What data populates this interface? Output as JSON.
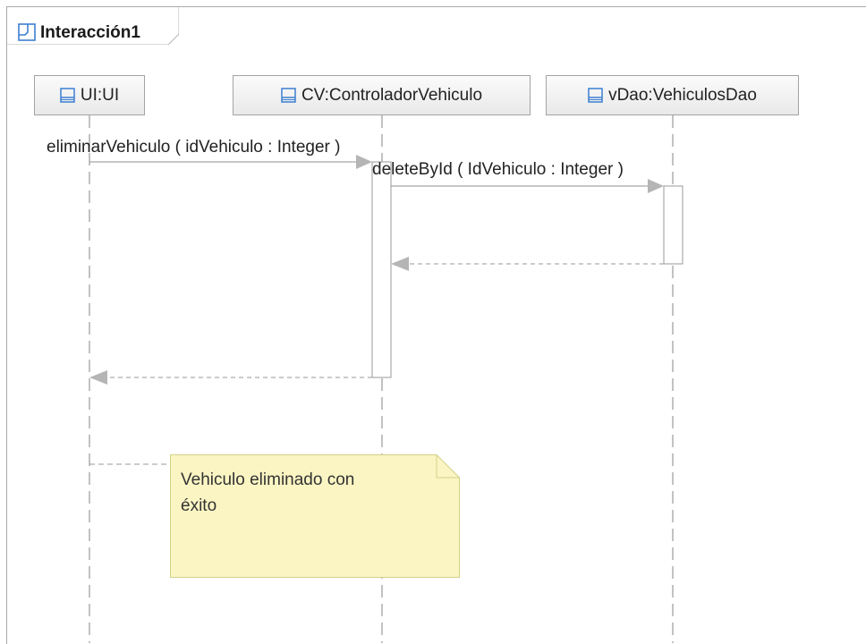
{
  "frame": {
    "title": "Interacción1",
    "icon": "frame-icon"
  },
  "lifelines": [
    {
      "label": "UI:UI",
      "icon": "lifeline-icon"
    },
    {
      "label": "CV:ControladorVehiculo",
      "icon": "lifeline-icon"
    },
    {
      "label": "vDao:VehiculosDao",
      "icon": "lifeline-icon"
    }
  ],
  "messages": [
    {
      "label": "eliminarVehiculo ( idVehiculo : Integer )",
      "kind": "synchronous"
    },
    {
      "label": "deleteById ( IdVehiculo : Integer )",
      "kind": "synchronous"
    },
    {
      "label": "",
      "kind": "return"
    },
    {
      "label": "",
      "kind": "return"
    }
  ],
  "note": {
    "text": "Vehiculo eliminado con\néxito"
  },
  "colors": {
    "line": "#8f8f8f",
    "arrowhead": "#b5b5b5",
    "note_fill": "#fbf5c3",
    "note_border": "#d2d28a",
    "head_border": "#a3a3a3",
    "frame_icon": "#3c7fd1"
  }
}
